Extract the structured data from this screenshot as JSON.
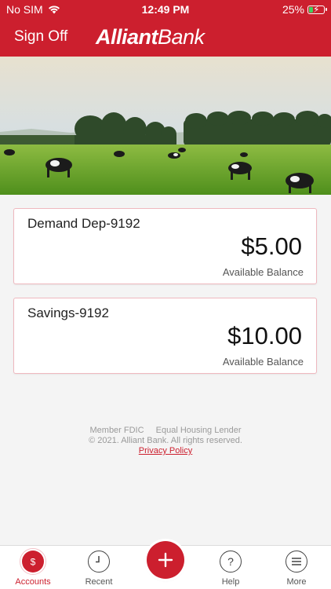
{
  "status_bar": {
    "carrier": "No SIM",
    "time": "12:49 PM",
    "battery": "25%"
  },
  "header": {
    "sign_off_label": "Sign Off",
    "brand_strong": "Alliant",
    "brand_light": "Bank"
  },
  "accounts": [
    {
      "name": "Demand Dep-9192",
      "amount": "$5.00",
      "label": "Available Balance"
    },
    {
      "name": "Savings-9192",
      "amount": "$10.00",
      "label": "Available Balance"
    }
  ],
  "footer": {
    "member": "Member FDIC",
    "lender": "Equal Housing Lender",
    "copyright": "© 2021. Alliant Bank. All rights reserved.",
    "privacy": "Privacy Policy"
  },
  "tabs": [
    {
      "label": "Accounts",
      "icon": "dollar-icon",
      "active": true
    },
    {
      "label": "Recent",
      "icon": "clock-icon"
    },
    {
      "label": "Help",
      "icon": "question-icon"
    },
    {
      "label": "More",
      "icon": "menu-icon"
    }
  ],
  "colors": {
    "brand_red": "#cc1f2e",
    "background": "#f4f4f4",
    "card_border": "#efb8bf"
  }
}
